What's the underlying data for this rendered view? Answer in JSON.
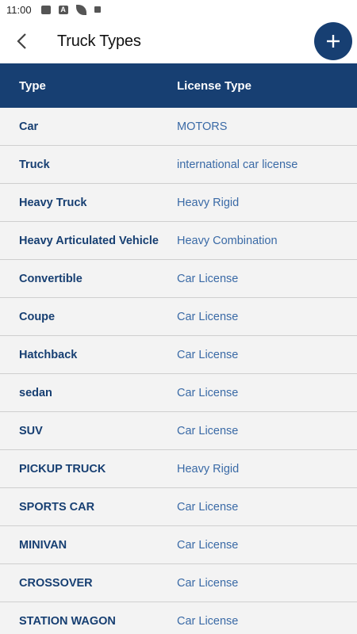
{
  "status_bar": {
    "time": "11:00",
    "icons": [
      "image-icon",
      "a-icon",
      "leaf-icon",
      "square-icon"
    ]
  },
  "header": {
    "title": "Truck Types",
    "back_icon": "chevron-left-icon",
    "add_icon": "plus-icon"
  },
  "colors": {
    "primary": "#173f72",
    "row_bg": "#f3f3f3",
    "type_text": "#173f72",
    "license_text": "#3a6aa6"
  },
  "table": {
    "columns": [
      "Type",
      "License Type"
    ],
    "rows": [
      {
        "type": "Car",
        "license": "MOTORS"
      },
      {
        "type": "Truck",
        "license": "international car license"
      },
      {
        "type": "Heavy Truck",
        "license": "Heavy Rigid"
      },
      {
        "type": "Heavy Articulated Vehicle",
        "license": "Heavy Combination"
      },
      {
        "type": "Convertible",
        "license": "Car License"
      },
      {
        "type": "Coupe",
        "license": "Car License"
      },
      {
        "type": "Hatchback",
        "license": "Car License"
      },
      {
        "type": "sedan",
        "license": "Car License"
      },
      {
        "type": "SUV",
        "license": "Car License"
      },
      {
        "type": "PICKUP TRUCK",
        "license": "Heavy Rigid"
      },
      {
        "type": "SPORTS CAR",
        "license": "Car License"
      },
      {
        "type": "MINIVAN",
        "license": "Car License"
      },
      {
        "type": "CROSSOVER",
        "license": "Car License"
      },
      {
        "type": "STATION WAGON",
        "license": "Car License"
      }
    ]
  }
}
